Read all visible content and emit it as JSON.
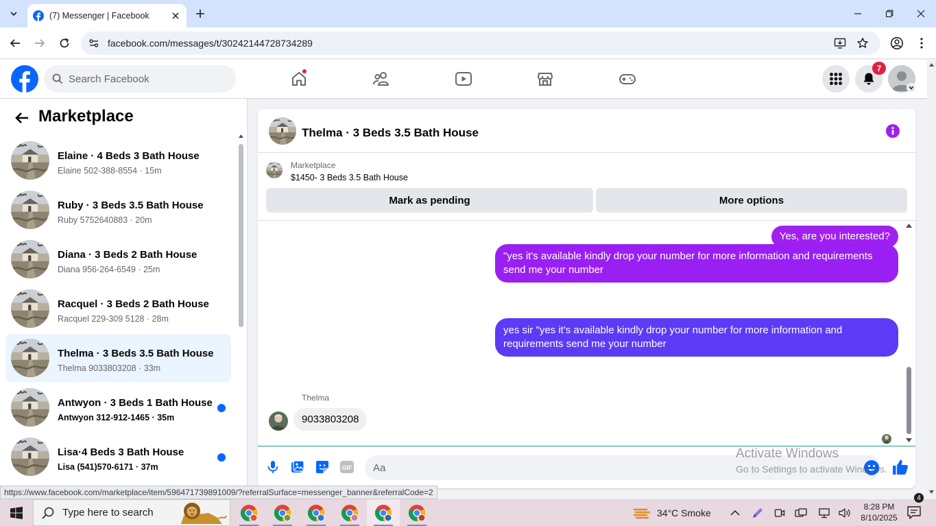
{
  "browser": {
    "tab_title": "(7) Messenger | Facebook",
    "url": "facebook.com/messages/t/30242144728734289",
    "status_url": "https://www.facebook.com/marketplace/item/596471739891009/?referralSurface=messenger_banner&referralCode=2"
  },
  "header": {
    "search_placeholder": "Search Facebook",
    "notifications_count": "7"
  },
  "sidebar": {
    "title": "Marketplace",
    "conversations": [
      {
        "name": "Elaine · 4 Beds 3 Bath House",
        "sub": "Elaine 502-388-8554 · 15m",
        "unread": false,
        "active": false
      },
      {
        "name": "Ruby · 3 Beds 3.5 Bath House",
        "sub": "Ruby 5752640883 · 20m",
        "unread": false,
        "active": false
      },
      {
        "name": "Diana · 3 Beds 2 Bath House",
        "sub": "Diana 956-264-6549 · 25m",
        "unread": false,
        "active": false
      },
      {
        "name": "Racquel · 3 Beds 2 Bath House",
        "sub": "Racquel 229-309 5128 · 28m",
        "unread": false,
        "active": false
      },
      {
        "name": "Thelma · 3 Beds 3.5 Bath House",
        "sub": "Thelma 9033803208 · 33m",
        "unread": false,
        "active": true
      },
      {
        "name": "Antwyon · 3 Beds 1 Bath House",
        "sub": "Antwyon 312-912-1465 · 35m",
        "unread": true,
        "active": false
      },
      {
        "name": "Lisa·4 Beds 3 Bath House",
        "sub": "Lisa (541)570-6171 · 37m",
        "unread": true,
        "active": false
      }
    ]
  },
  "chat": {
    "title": "Thelma · 3 Beds 3.5 Bath House",
    "listing_label": "Marketplace",
    "listing_desc": "$1450- 3 Beds 3.5 Bath House",
    "mark_pending_label": "Mark as pending",
    "more_options_label": "More options",
    "messages": [
      {
        "from": "me",
        "text": "Yes, are you interested?"
      },
      {
        "from": "me",
        "text": "\"yes it's available kindly drop your number for more information and requirements send me your number"
      },
      {
        "from": "me",
        "text": "yes sir \"yes it's available kindly drop your number for more information and requirements send me your number"
      },
      {
        "from": "Thelma",
        "text": "9033803208"
      }
    ],
    "composer_placeholder": "Aa"
  },
  "watermark": {
    "line1": "Activate Windows",
    "line2": "Go to Settings to activate Windows."
  },
  "taskbar": {
    "search_placeholder": "Type here to search",
    "weather": "34°C  Smoke",
    "time": "8:28 PM",
    "date": "8/10/2025",
    "notification_count": "4"
  },
  "colors": {
    "fb_blue": "#0866ff",
    "bubble_purple": "#a020f0",
    "bubble_violet": "#5b3bf5",
    "unread_dot": "#0866ff",
    "badge_red": "#e41e3f"
  }
}
